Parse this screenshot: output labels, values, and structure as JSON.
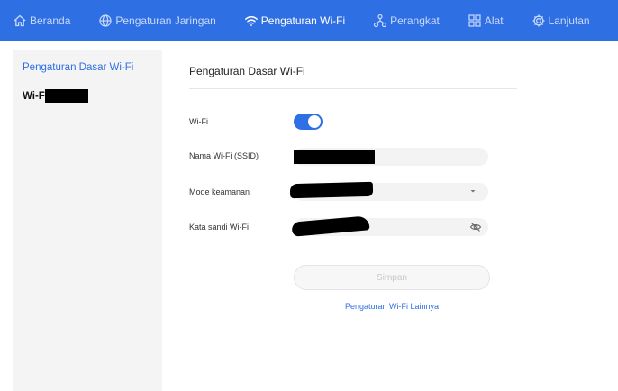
{
  "colors": {
    "nav_background": "#2f6fe4",
    "accent": "#2f6fe4",
    "nav_inactive_text": "#c9dafb",
    "sidebar_background": "#f4f4f4"
  },
  "topnav": {
    "items": [
      {
        "label": "Beranda",
        "icon": "home-icon",
        "active": false
      },
      {
        "label": "Pengaturan Jaringan",
        "icon": "globe-icon",
        "active": false
      },
      {
        "label": "Pengaturan Wi-Fi",
        "icon": "wifi-icon",
        "active": true
      },
      {
        "label": "Perangkat",
        "icon": "devices-icon",
        "active": false
      },
      {
        "label": "Alat",
        "icon": "tools-icon",
        "active": false
      },
      {
        "label": "Lanjutan",
        "icon": "gear-icon",
        "active": false
      }
    ]
  },
  "sidebar": {
    "items": [
      {
        "label": "Pengaturan Dasar Wi-Fi",
        "active": true
      },
      {
        "label": "Wi-F",
        "active": false
      }
    ]
  },
  "main": {
    "title": "Pengaturan Dasar Wi-Fi",
    "wifi": {
      "label": "Wi-Fi",
      "enabled": true
    },
    "ssid": {
      "label": "Nama Wi-Fi (SSID)",
      "value": ""
    },
    "security": {
      "label": "Mode keamanan",
      "value": "",
      "icon": "chevron-down-icon"
    },
    "password": {
      "label": "Kata sandi Wi-Fi",
      "value": "",
      "icon": "eye-off-icon"
    },
    "save_label": "Simpan",
    "more_link": "Pengaturan Wi-Fi Lainnya"
  }
}
